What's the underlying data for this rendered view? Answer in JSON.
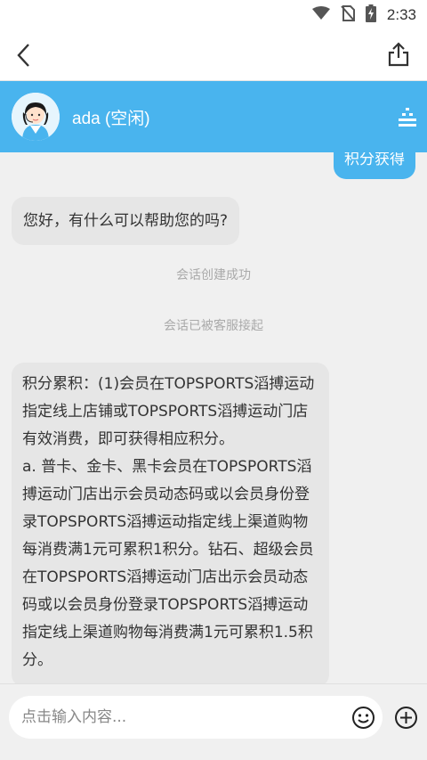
{
  "status_bar": {
    "time": "2:33",
    "icons": [
      "wifi-icon",
      "no-sim-icon",
      "battery-charging-icon"
    ]
  },
  "nav": {
    "back_icon": "chevron-left-icon",
    "share_icon": "share-icon"
  },
  "agent": {
    "name": "ada (空闲)",
    "avatar": "agent-avatar",
    "menu_icon": "menu-icon"
  },
  "colors": {
    "accent": "#49b4ee",
    "received_bubble": "#e6e6e6",
    "system_text": "#aaaaaa"
  },
  "messages": {
    "sent_1": "积分获得",
    "received_1": "您好，有什么可以帮助您的吗?",
    "system_1": "会话创建成功",
    "system_2": "会话已被客服接起",
    "received_2": "积分累积：(1)会员在TOPSPORTS滔搏运动指定线上店铺或TOPSPORTS滔搏运动门店有效消费，即可获得相应积分。\na. 普卡、金卡、黑卡会员在TOPSPORTS滔搏运动门店出示会员动态码或以会员身份登录TOPSPORTS滔搏运动指定线上渠道购物每消费满1元可累积1积分。钻石、超级会员在TOPSPORTS滔搏运动门店出示会员动态码或以会员身份登录TOPSPORTS滔搏运动指定线上渠道购物每消费满1元可累积1.5积分。"
  },
  "input": {
    "placeholder": "点击输入内容...",
    "value": "",
    "emoji_icon": "emoji-icon",
    "plus_icon": "plus-icon"
  }
}
